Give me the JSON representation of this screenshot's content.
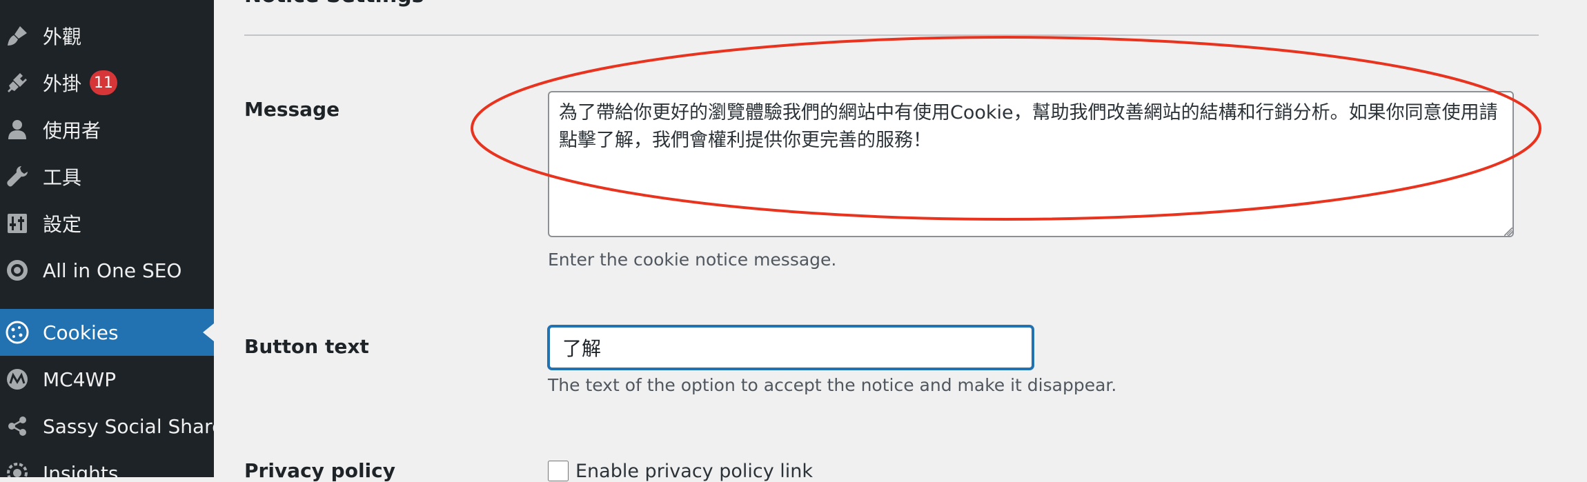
{
  "sidebar": {
    "items": [
      {
        "label": "外觀",
        "icon": "paintbrush-icon"
      },
      {
        "label": "外掛",
        "icon": "plugin-icon",
        "badge": "11"
      },
      {
        "label": "使用者",
        "icon": "user-icon"
      },
      {
        "label": "工具",
        "icon": "wrench-icon"
      },
      {
        "label": "設定",
        "icon": "settings-sliders-icon"
      },
      {
        "label": "All in One SEO",
        "icon": "aioseo-gear-icon"
      },
      {
        "label": "Cookies",
        "icon": "cookie-icon",
        "active": true
      },
      {
        "label": "MC4WP",
        "icon": "mc4wp-icon"
      },
      {
        "label": "Sassy Social Share",
        "icon": "share-icon"
      },
      {
        "label": "Insights",
        "icon": "insights-gear-icon"
      }
    ]
  },
  "main": {
    "section_heading": "Notice Settings",
    "message": {
      "label": "Message",
      "value": "為了帶給你更好的瀏覽體驗我們的網站中有使用Cookie，幫助我們改善網站的結構和行銷分析。如果你同意使用請點擊了解，我們會權利提供你更完善的服務！",
      "help": "Enter the cookie notice message."
    },
    "button_text": {
      "label": "Button text",
      "value": "了解",
      "help": "The text of the option to accept the notice and make it disappear."
    },
    "privacy_policy": {
      "label": "Privacy policy",
      "checkbox_label": "Enable privacy policy link"
    }
  },
  "colors": {
    "sidebar_bg": "#1d2327",
    "active_bg": "#2271b1",
    "badge_bg": "#d63638",
    "annotation": "#e8331f"
  }
}
